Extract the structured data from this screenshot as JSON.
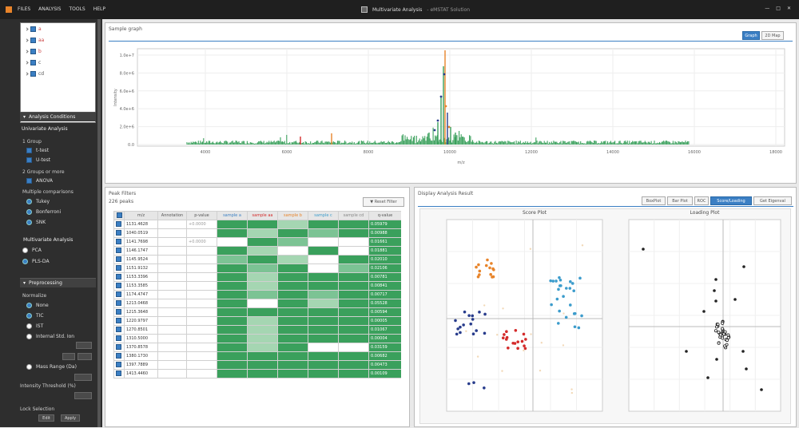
{
  "titlebar": {
    "menu": [
      "FILES",
      "ANALYSIS",
      "TOOLS",
      "HELP"
    ],
    "title": "Multivariate Analysis",
    "subtitle": "- eMSTAT Solution"
  },
  "sidebar": {
    "tree": [
      {
        "label": "a",
        "color": "#c44"
      },
      {
        "label": "aa",
        "color": "#c44"
      },
      {
        "label": "b",
        "color": "#c44"
      },
      {
        "label": "c",
        "color": "#333"
      },
      {
        "label": "cd",
        "color": "#333"
      }
    ],
    "analysis_header": "Analysis Conditions",
    "univariate_title": "Univariate Analysis",
    "groups_label": "1 Group",
    "groups": [
      "t-test",
      "U-test"
    ],
    "groups2_label": "2 Groups or more",
    "anova_label": "ANOVA",
    "multiple_label": "Multiple comparisons",
    "multiple_opts": [
      "Tukey",
      "Bonferroni",
      "SNK"
    ],
    "multivariate_title": "Multivariate Analysis",
    "multivariate_opts": [
      "PCA",
      "PLS-DA"
    ],
    "preprocess_header": "Preprocessing",
    "normalize_label": "Normalize",
    "normalize_opts": [
      "None",
      "TIC",
      "IST",
      "Internal Std. Ion"
    ],
    "mass_range_label": "Mass Range (Da)",
    "threshold_label": "Intensity Threshold (%)",
    "lock_label": "Lock Selection",
    "buttons": [
      "Edit",
      "Apply"
    ]
  },
  "sample_graph": {
    "title": "Sample graph",
    "tabs": [
      "Graph",
      "2D Map"
    ],
    "ylabel": "Intensity",
    "xlabel": "m/z",
    "x_ticks": [
      "4000",
      "6000",
      "8000",
      "10000",
      "12000",
      "14000",
      "16000",
      "18000"
    ],
    "y_ticks": [
      "1.0e+7",
      "8.0e+6",
      "6.0e+6",
      "4.0e+6",
      "2.0e+6",
      "0.0"
    ]
  },
  "peak_filter": {
    "title": "Peak Filters",
    "count": "226 peaks",
    "reset_label": "Reset Filter",
    "columns": [
      "",
      "m/z",
      "Annotation",
      "p-value",
      "sample a",
      "sample aa",
      "sample b",
      "sample c",
      "sample cd",
      "q-value"
    ],
    "rows": [
      [
        "1131.4628",
        "",
        "+0.0000",
        "0.05979"
      ],
      [
        "1040.0519",
        "",
        "",
        "0.00988"
      ],
      [
        "1141.7698",
        "",
        "+0.0000",
        "0.01661"
      ],
      [
        "1146.1747",
        "",
        "",
        "0.01881"
      ],
      [
        "1145.9524",
        "",
        "",
        "0.02010"
      ],
      [
        "1151.9132",
        "",
        "",
        "0.02106"
      ],
      [
        "1153.3396",
        "",
        "",
        "0.00781"
      ],
      [
        "1153.3585",
        "",
        "",
        "0.00841"
      ],
      [
        "1174.4747",
        "",
        "",
        "0.00717"
      ],
      [
        "1213.0468",
        "",
        "",
        "0.05528"
      ],
      [
        "1215.3648",
        "",
        "",
        "0.00594"
      ],
      [
        "1220.9797",
        "",
        "",
        "0.00005"
      ],
      [
        "1270.8501",
        "",
        "",
        "0.01067"
      ],
      [
        "1310.5000",
        "",
        "",
        "0.00004"
      ],
      [
        "1370.8578",
        "",
        "",
        "0.03159"
      ],
      [
        "1380.1730",
        "",
        "",
        "0.00682"
      ],
      [
        "1397.7889",
        "",
        "",
        "0.00473"
      ],
      [
        "1413.4460",
        "",
        "",
        "0.00109"
      ]
    ]
  },
  "display": {
    "title": "Display Analysis Result",
    "tabs": [
      "BoxPlot",
      "Bar Plot",
      "ROC",
      "Score/Loading",
      "Get Eigenval"
    ],
    "score_title": "Score Plot",
    "loading_title": "Loading Plot"
  },
  "colors": {
    "accent": "#3b7fc4",
    "green": "#3aa05c",
    "orange": "#e8842a",
    "red": "#d42a2a",
    "navy": "#283c8c",
    "cyan": "#3c9ccc"
  }
}
